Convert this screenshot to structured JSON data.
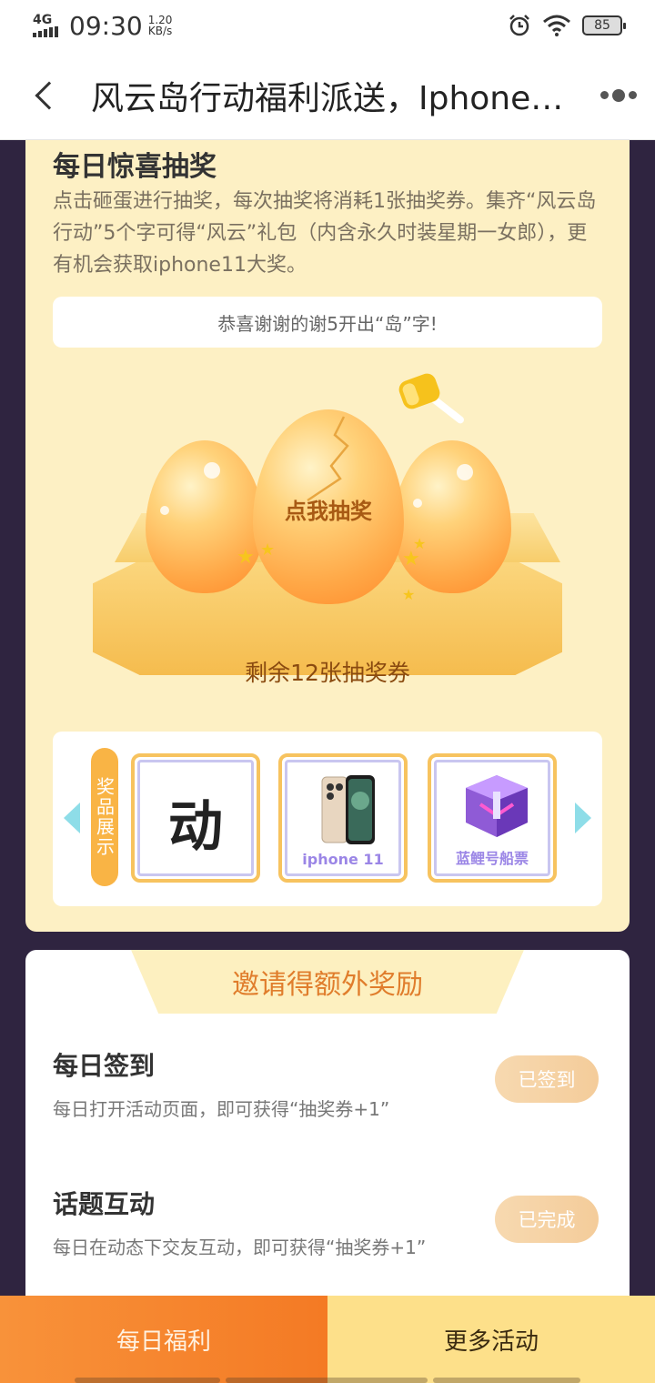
{
  "status_bar": {
    "network": "4G",
    "time": "09:30",
    "speed_value": "1.20",
    "speed_unit": "KB/s",
    "battery": "85"
  },
  "header": {
    "title": "风云岛行动福利派送，Iphone…",
    "back_icon": "back-chevron-icon",
    "more_icon": "more-dots-icon"
  },
  "lottery": {
    "title": "每日惊喜抽奖",
    "description": "点击砸蛋进行抽奖，每次抽奖将消耗1张抽奖券。集齐“风云岛行动”5个字可得“风云”礼包（内含永久时装星期一女郎），更有机会获取iphone11大奖。",
    "result_text": "恭喜谢谢的谢5开出“岛”字!",
    "egg_button": "点我抽奖",
    "tickets_remaining": "剩余12张抽奖券"
  },
  "prizes": {
    "tag": "奖品展示",
    "items": [
      {
        "char": "动",
        "label": ""
      },
      {
        "char": "",
        "label": "iphone 11"
      },
      {
        "char": "",
        "label": "蓝鲤号船票"
      }
    ]
  },
  "invite": {
    "ribbon": "邀请得额外奖励",
    "tasks": [
      {
        "title": "每日签到",
        "desc": "每日打开活动页面，即可获得“抽奖券+1”",
        "button": "已签到"
      },
      {
        "title": "话题互动",
        "desc": "每日在动态下交友互动，即可获得“抽奖券+1”",
        "button": "已完成"
      }
    ]
  },
  "bottom_tabs": {
    "left": "每日福利",
    "right": "更多活动"
  },
  "colors": {
    "background": "#2f2440",
    "card": "#fdf0c4",
    "accent_orange": "#f47a24",
    "ribbon_text": "#e07d2c"
  }
}
